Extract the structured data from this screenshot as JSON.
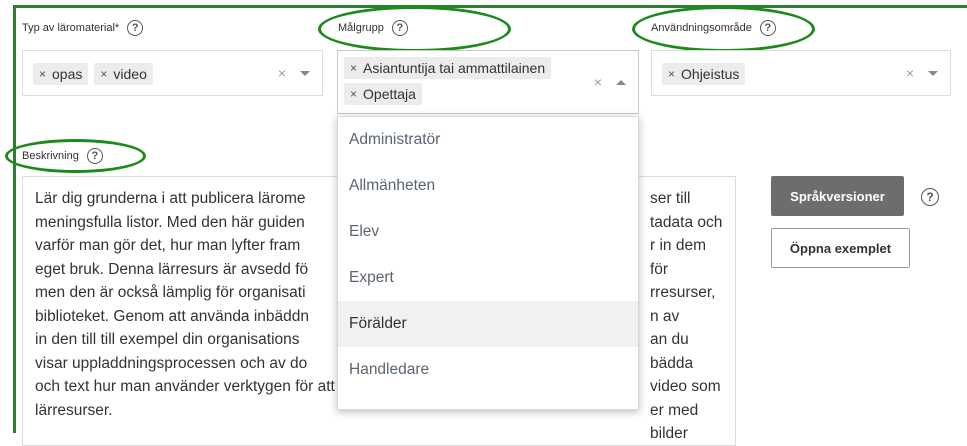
{
  "fields": {
    "type": {
      "label": "Typ av läromaterial*",
      "help": "?",
      "chips": [
        "opas",
        "video"
      ]
    },
    "audience": {
      "label": "Målgrupp",
      "help": "?",
      "chips": [
        "Asiantuntija tai ammattilainen",
        "Opettaja"
      ],
      "options": [
        "Administratör",
        "Allmänheten",
        "Elev",
        "Expert",
        "Förälder",
        "Handledare"
      ],
      "highlighted": "Förälder"
    },
    "usage": {
      "label": "Användningsområde",
      "help": "?",
      "chips": [
        "Ohjeistus"
      ]
    },
    "description": {
      "label": "Beskrivning",
      "help": "?",
      "lines": [
        "Lär dig grunderna i att publicera lärome",
        "meningsfulla listor. Med den här guiden",
        "varför man gör det, hur man lyfter fram",
        "eget bruk. Denna lärresurs är avsedd fö",
        "men den är också lämplig för organisati",
        "biblioteket. Genom att använda inbäddn",
        "in den till till exempel din organisations",
        "visar uppladdningsprocessen och av do",
        "och text hur man använder verktygen för att ladda upp, redigera, granska och samla",
        "lärresurser."
      ],
      "right_fragments": [
        "ser till",
        "tadata och",
        "r in dem för",
        "rresurser,",
        "n av",
        "an du bädda",
        "video som",
        "er med bilder"
      ]
    }
  },
  "clear_glyph": "×",
  "buttons": {
    "language_versions": "Språkversioner",
    "open_example": "Öppna exemplet",
    "help": "?"
  },
  "colors": {
    "annotation_green": "#1b8a1b",
    "frame_green": "#2e7d32",
    "button_gray": "#6d6d6d"
  }
}
